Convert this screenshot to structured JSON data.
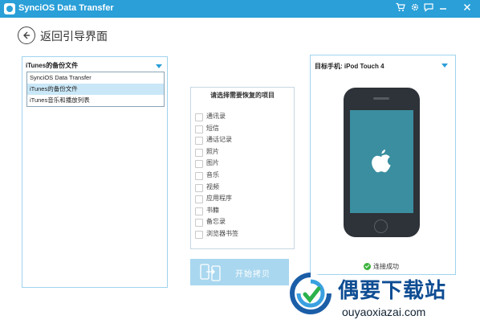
{
  "window": {
    "title": "SynciOS Data Transfer"
  },
  "titlebar_icons": [
    "cart-icon",
    "gear-icon",
    "chat-icon",
    "minimize-icon",
    "close-icon"
  ],
  "nav": {
    "back_label": "返回引导界面"
  },
  "source": {
    "selected": "iTunes的备份文件",
    "options": [
      "SynciOS Data Transfer",
      "iTunes的备份文件",
      "iTunes音乐和播放列表"
    ],
    "highlighted_index": 1
  },
  "restore": {
    "title": "请选择需要恢复的项目",
    "items": [
      "通讯录",
      "短信",
      "通话记录",
      "照片",
      "图片",
      "音乐",
      "视频",
      "应用程序",
      "书籍",
      "备忘录",
      "浏览器书签"
    ]
  },
  "action": {
    "start_label": "开始拷贝"
  },
  "target": {
    "title": "目标手机: iPod Touch 4",
    "status": "连接成功",
    "status_color": "#3db33d"
  },
  "watermark": {
    "text": "偶要下载站",
    "url": "ouyaoxiazai.com"
  },
  "colors": {
    "accent": "#2a9fd8",
    "panel_border": "#9fd3ee",
    "button_disabled": "#a9d7ef"
  }
}
